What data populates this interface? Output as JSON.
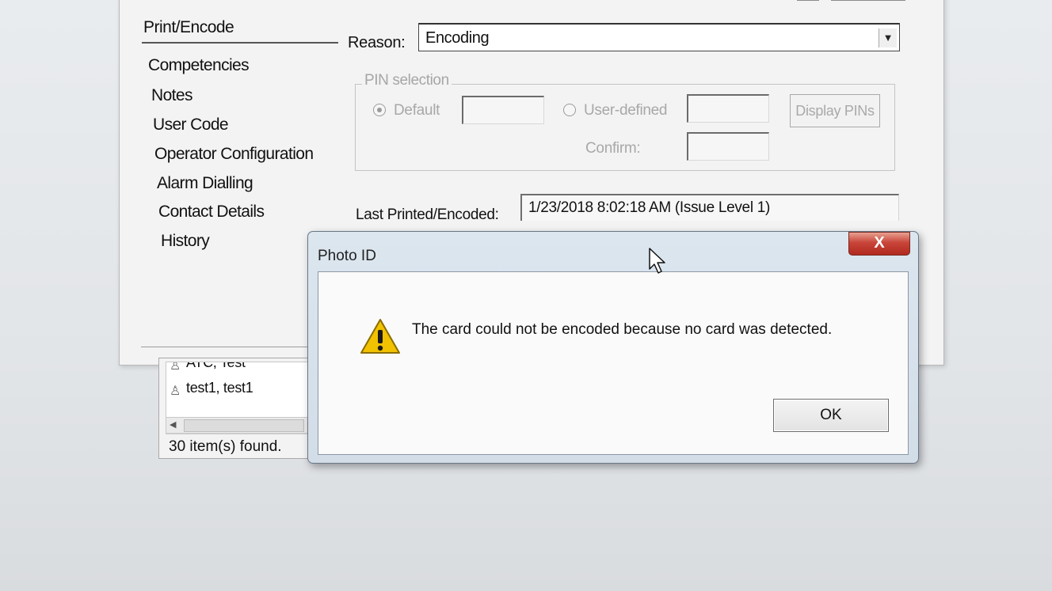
{
  "main_window": {
    "nav": {
      "header": "Print/Encode",
      "items": [
        {
          "label": "Competencies"
        },
        {
          "label": "Notes"
        },
        {
          "label": "User Code"
        },
        {
          "label": "Operator Configuration"
        },
        {
          "label": "Alarm Dialling"
        },
        {
          "label": "Contact Details"
        },
        {
          "label": "History"
        }
      ]
    },
    "reason": {
      "label": "Reason:",
      "value": "Encoding"
    },
    "pin_selection": {
      "legend": "PIN selection",
      "default_label": "Default",
      "user_defined_label": "User-defined",
      "confirm_label": "Confirm:",
      "display_pins_label": "Display PINs"
    },
    "last_printed": {
      "label": "Last Printed/Encoded:",
      "value": "1/23/2018 8:02:18 AM (Issue Level 1)"
    }
  },
  "user_list": {
    "rows": [
      {
        "name": "ATC, Test"
      },
      {
        "name": "test1, test1"
      }
    ],
    "status": "30 item(s) found."
  },
  "dialog": {
    "title": "Photo ID",
    "close_glyph": "X",
    "icon": "warning-icon",
    "message": "The card could not be encoded because no card was detected.",
    "ok_label": "OK"
  },
  "colors": {
    "close_button": "#c9453a",
    "warning_fill": "#f2c100",
    "dialog_frame": "#d2dde8"
  }
}
